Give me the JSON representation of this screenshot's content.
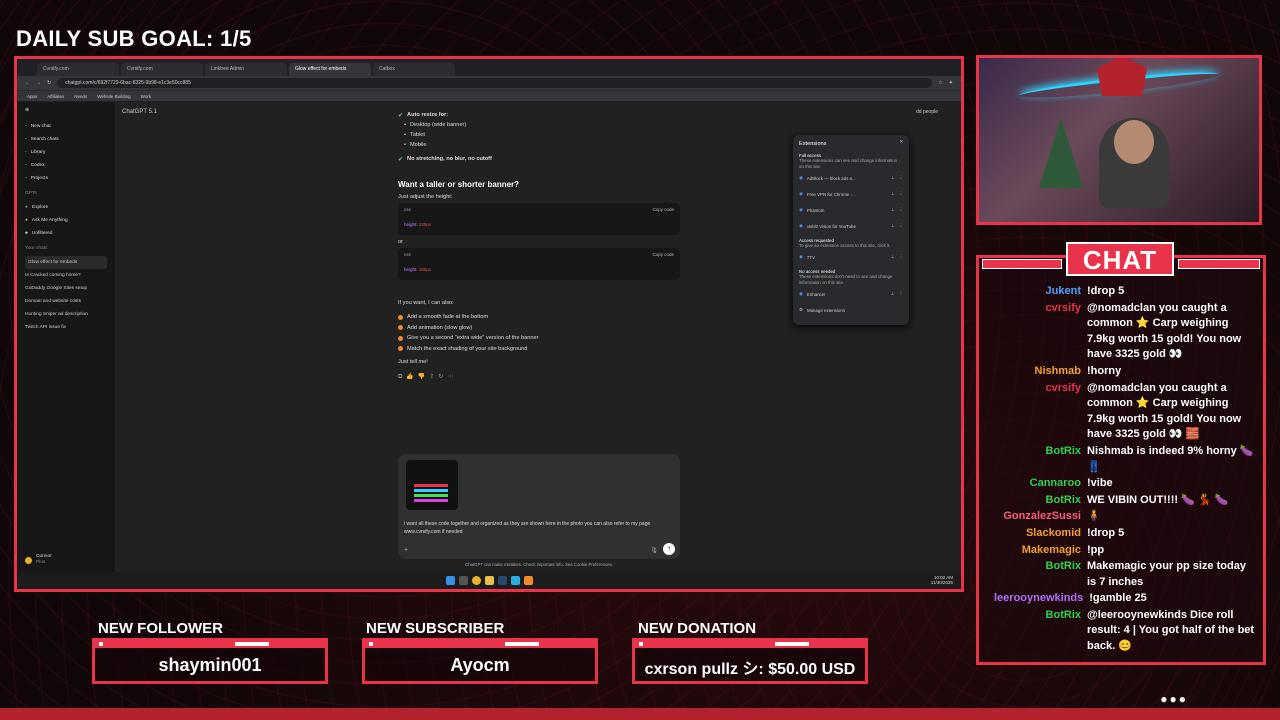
{
  "overlay": {
    "goal_label": "DAILY SUB GOAL: 1/5",
    "chat_title": "CHAT",
    "alerts": [
      {
        "label": "NEW FOLLOWER",
        "value": "shaymin001"
      },
      {
        "label": "NEW SUBSCRIBER",
        "value": "Ayocm"
      },
      {
        "label": "NEW DONATION",
        "value": "cxrson pullz シ: $50.00 USD"
      }
    ],
    "accent": "#e8334a"
  },
  "browser": {
    "tabs": [
      "Cvrsify.com",
      "Cvrsify.com",
      "Linktree Admin",
      "Glow effect for embeds",
      "Catbox"
    ],
    "address": "chatgpt.com/c/692f7729-6bac-8325-9b98-e1c3e50cc885",
    "bookmarks": [
      "Apps",
      "Affiliates",
      "Needs",
      "Website Building",
      "Work"
    ]
  },
  "chatgpt": {
    "model": "ChatGPT 5.1",
    "sidebar": {
      "top": [
        "New chat",
        "Search chats",
        "Library",
        "Codex",
        "Projects"
      ],
      "gpts_label": "GPTs",
      "gpts": [
        "Explore",
        "Ask Me Anything",
        "Unfiltered"
      ],
      "chats_label": "Your chats",
      "chats": [
        "Glow effect for embeds",
        "Is Cracked coming home?",
        "GoDaddy Google Sites setup",
        "Domain and website costs",
        "Hunting Sniper ad description",
        "Twitch API issue fix"
      ],
      "user_name": "Connor",
      "user_plan": "Plus"
    },
    "content": {
      "resize_title": "Auto resize for:",
      "resize_items": [
        "Desktop (wide banner)",
        "Tablet",
        "Mobile"
      ],
      "no_stretch": "No stretching, no blur, no cutoff",
      "heading": "Want a taller or shorter banner?",
      "adjust": "Just adjust the height:",
      "code_lang": "css",
      "copy_label": "Copy code",
      "code_prop": "height:",
      "code_val1": "120px",
      "code_val2": "180px",
      "or": "or",
      "offer": "If you want, I can also:",
      "offer_items": [
        "Add a smooth fade at the bottom",
        "Add animation (slow glow)",
        "Give you a second \"extra wide\" version of the banner",
        "Match the exact shading of your site background"
      ],
      "closing": "Just tell me!",
      "prompt": "i want all these code together and organized as they are shown here in the photo you can also refer to my page www.cvrsify.com if needed",
      "disclaimer": "ChatGPT can make mistakes. Check important info. See Cookie Preferences."
    },
    "extensions": {
      "title": "Extensions",
      "full_access": "Full access",
      "full_desc": "These extensions can see and change information on this site.",
      "full_items": [
        "AdBlock — block ads a...",
        "Free VPN for Chrome -...",
        "Phantom",
        "visbl2 Vision for YouTube"
      ],
      "requested": "Access requested",
      "requested_desc": "To give an extension access to this site, click it.",
      "requested_items": [
        "7TV"
      ],
      "none": "No access needed",
      "none_desc": "These extensions don't need to see and change information on this site.",
      "none_items": [
        "Enhancer"
      ],
      "manage": "Manage extensions"
    },
    "share_people": "dd people",
    "clock_time": "10:02 AM",
    "clock_date": "11/30/2025"
  },
  "chat": [
    {
      "user": "Jukent",
      "color": "#4aa3ff",
      "text": "!drop 5"
    },
    {
      "user": "cvrsify",
      "color": "#e8334a",
      "text": "@nomadclan you caught a common ⭐ Carp weighing 7.9kg worth 15 gold! You now have 3325 gold 👀"
    },
    {
      "user": "Nishmab",
      "color": "#f0a030",
      "text": "!horny"
    },
    {
      "user": "cvrsify",
      "color": "#e8334a",
      "text": "@nomadclan you caught a common ⭐ Carp weighing 7.9kg worth 15 gold! You now have 3325 gold 👀 🧱"
    },
    {
      "user": "BotRix",
      "color": "#2fd14a",
      "text": "Nishmab is indeed 9% horny 🍆 👖"
    },
    {
      "user": "Cannaroo",
      "color": "#2fd14a",
      "text": "!vibe"
    },
    {
      "user": "BotRix",
      "color": "#2fd14a",
      "text": "WE VIBIN OUT!!!! 🍆 💃 🍆"
    },
    {
      "user": "GonzalezSussi",
      "color": "#ff5a7a",
      "text": "🧍"
    },
    {
      "user": "Slackomid",
      "color": "#f0a030",
      "text": "!drop 5"
    },
    {
      "user": "Makemagic",
      "color": "#f0a030",
      "text": "!pp"
    },
    {
      "user": "BotRix",
      "color": "#2fd14a",
      "text": "Makemagic your pp size today is 7 inches"
    },
    {
      "user": "leerooynewkinds",
      "color": "#b070ff",
      "text": "!gamble 25"
    },
    {
      "user": "BotRix",
      "color": "#2fd14a",
      "text": "@leerooynewkinds Dice roll result: 4 | You got half of the bet back. 😊"
    }
  ]
}
